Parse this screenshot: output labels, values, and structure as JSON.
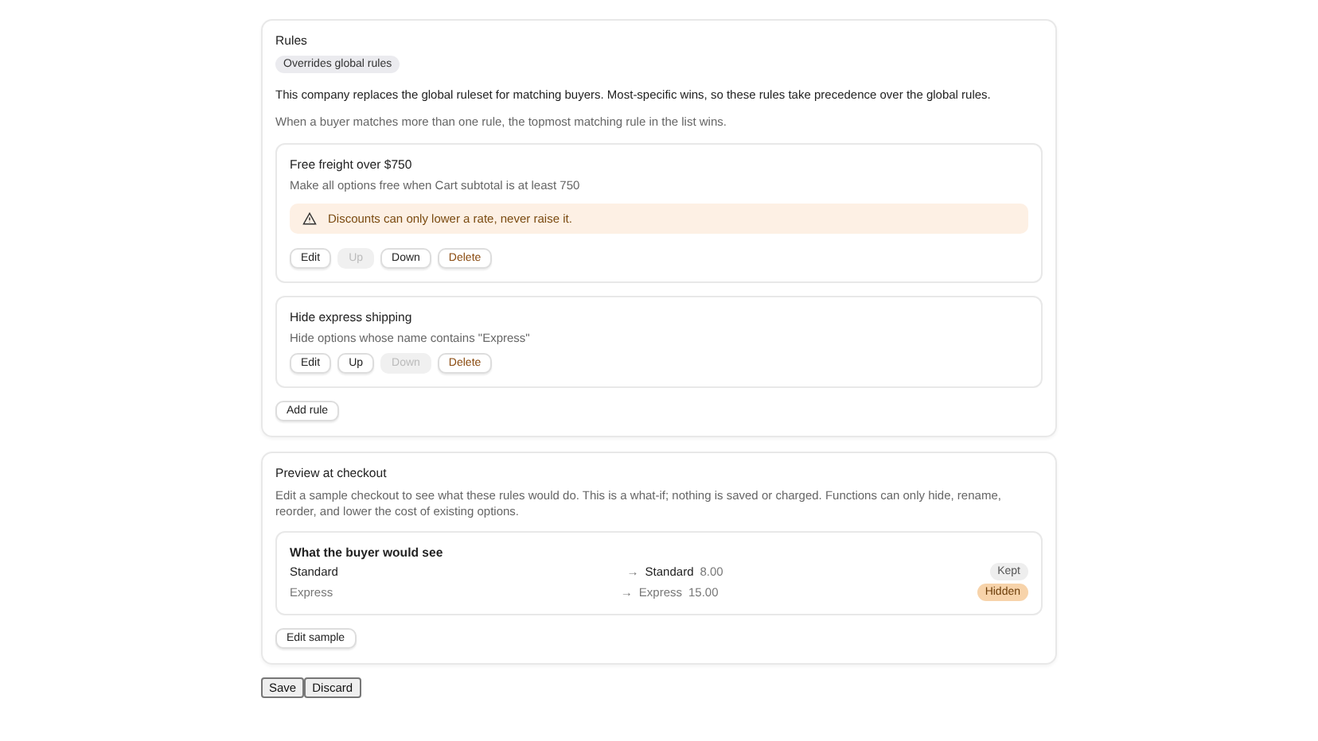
{
  "rules_card": {
    "title": "Rules",
    "badge": "Overrides global rules",
    "description": "This company replaces the global ruleset for matching buyers. Most-specific wins, so these rules take precedence over the global rules.",
    "note": "When a buyer matches more than one rule, the topmost matching rule in the list wins.",
    "rules": [
      {
        "title": "Free freight over $750",
        "summary": "Make all options free when Cart subtotal is at least 750",
        "warning": "Discounts can only lower a rate, never raise it.",
        "actions": [
          {
            "kind": "plain",
            "label": "Edit",
            "disabled": false
          },
          {
            "kind": "plain",
            "label": "Up",
            "disabled": true
          },
          {
            "kind": "plain",
            "label": "Down",
            "disabled": false
          },
          {
            "kind": "danger",
            "label": "Delete",
            "disabled": false
          }
        ]
      },
      {
        "title": "Hide express shipping",
        "summary": "Hide options whose name contains \"Express\"",
        "actions": [
          {
            "kind": "plain",
            "label": "Edit",
            "disabled": false
          },
          {
            "kind": "plain",
            "label": "Up",
            "disabled": false
          },
          {
            "kind": "plain",
            "label": "Down",
            "disabled": true
          },
          {
            "kind": "danger",
            "label": "Delete",
            "disabled": false
          }
        ]
      }
    ],
    "add_button": "Add rule"
  },
  "preview_card": {
    "title": "Preview at checkout",
    "description": "Edit a sample checkout to see what these rules would do. This is a what-if; nothing is saved or charged. Functions can only hide, rename, reorder, and lower the cost of existing options.",
    "result": {
      "title": "What the buyer would see",
      "rows": [
        {
          "name": "Standard",
          "arrow": "→",
          "new_name": "Standard",
          "price": "8.00",
          "status": "Kept",
          "kind": "kept"
        },
        {
          "name": "Express",
          "arrow": "→",
          "new_name": "Express",
          "price": "15.00",
          "status": "Hidden",
          "kind": "hidden"
        }
      ]
    },
    "edit_button": "Edit sample"
  },
  "footer_buttons": [
    "Save",
    "Discard"
  ]
}
